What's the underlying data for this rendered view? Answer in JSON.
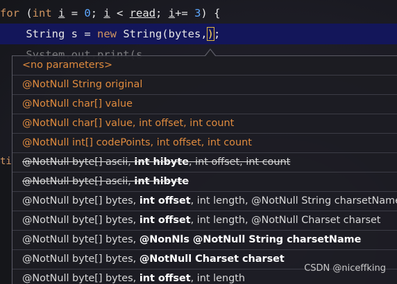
{
  "editor": {
    "line1": {
      "kw_for": "for",
      "open": " (",
      "kw_int": "int",
      "sp1": " ",
      "var_i": "i",
      "mid1": " = ",
      "zero": "0",
      "semi1": "; ",
      "var_i2": "i",
      "mid2": " < ",
      "var_read": "read",
      "semi2": "; ",
      "var_i3": "i",
      "mid3": "+= ",
      "three": "3",
      "close": ") {"
    },
    "line2": {
      "indent": "    String s = ",
      "kw_new": "new",
      "rest": " String(bytes,",
      "caret_paren": ")",
      "end": ";"
    },
    "line3": "    System.out.print(s"
  },
  "gutter_stub": "ti",
  "popup": {
    "rows": [
      {
        "style": "orange",
        "deprecated": false,
        "pre": "<no parameters>",
        "bold": "",
        "post": ""
      },
      {
        "style": "orange",
        "deprecated": false,
        "pre": "@NotNull String original",
        "bold": "",
        "post": ""
      },
      {
        "style": "orange",
        "deprecated": false,
        "pre": "@NotNull char[] value",
        "bold": "",
        "post": ""
      },
      {
        "style": "orange",
        "deprecated": false,
        "pre": "@NotNull char[] value, int offset, int count",
        "bold": "",
        "post": ""
      },
      {
        "style": "orange",
        "deprecated": false,
        "pre": "@NotNull int[] codePoints, int offset, int count",
        "bold": "",
        "post": ""
      },
      {
        "style": "normal",
        "deprecated": true,
        "pre": "@NotNull byte[] ascii, ",
        "bold": "int hibyte",
        "post": ", int offset, int count"
      },
      {
        "style": "normal",
        "deprecated": true,
        "pre": "@NotNull byte[] ascii, ",
        "bold": "int hibyte",
        "post": ""
      },
      {
        "style": "normal",
        "deprecated": false,
        "pre": "@NotNull byte[] bytes, ",
        "bold": "int offset",
        "post": ", int length, @NotNull String charsetName"
      },
      {
        "style": "normal",
        "deprecated": false,
        "pre": "@NotNull byte[] bytes, ",
        "bold": "int offset",
        "post": ", int length, @NotNull Charset charset"
      },
      {
        "style": "normal",
        "deprecated": false,
        "pre": "@NotNull byte[] bytes, ",
        "bold": "@NonNls @NotNull String charsetName",
        "post": ""
      },
      {
        "style": "normal",
        "deprecated": false,
        "pre": "@NotNull byte[] bytes, ",
        "bold": "@NotNull Charset charset",
        "post": ""
      },
      {
        "style": "normal",
        "deprecated": false,
        "pre": "@NotNull byte[] bytes, ",
        "bold": "int offset",
        "post": ", int length"
      }
    ]
  },
  "watermark": "CSDN @niceffking"
}
